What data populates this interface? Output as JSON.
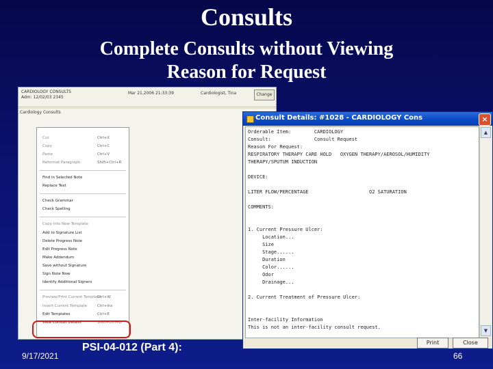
{
  "slide": {
    "title": "Consults",
    "subtitle_line1": "Complete Consults without Viewing",
    "subtitle_line2": "Reason for Request"
  },
  "left_screen": {
    "patient_name": "CARDIOLOGY CONSULTS",
    "admission": "Adm: 12/02/03 2345",
    "date_time": "Mar 21,2006 21:33:39",
    "provider": "Cardiologist, Tina",
    "change_button": "Change",
    "tab_label": "Cardiology Consults",
    "context_menu": [
      {
        "label": "Cut",
        "shortcut": "Ctrl+X",
        "disabled": true
      },
      {
        "label": "Copy",
        "shortcut": "Ctrl+C",
        "disabled": true
      },
      {
        "label": "Paste",
        "shortcut": "Ctrl+V",
        "disabled": true
      },
      {
        "label": "Reformat Paragraph",
        "shortcut": "Shift+Ctrl+R",
        "disabled": true
      },
      {
        "label": "Find in Selected Note",
        "shortcut": "",
        "disabled": false
      },
      {
        "label": "Replace Text",
        "shortcut": "",
        "disabled": false
      },
      {
        "label": "Check Grammar",
        "shortcut": "",
        "disabled": false
      },
      {
        "label": "Check Spelling",
        "shortcut": "",
        "disabled": false
      },
      {
        "label": "Copy into New Template",
        "shortcut": "",
        "disabled": true
      },
      {
        "label": "Add to Signature List",
        "shortcut": "",
        "disabled": false
      },
      {
        "label": "Delete Progress Note",
        "shortcut": "",
        "disabled": false
      },
      {
        "label": "Edit Progress Note",
        "shortcut": "",
        "disabled": false
      },
      {
        "label": "Make Addendum",
        "shortcut": "",
        "disabled": false
      },
      {
        "label": "Save without Signature",
        "shortcut": "",
        "disabled": false
      },
      {
        "label": "Sign Note Now",
        "shortcut": "",
        "disabled": false
      },
      {
        "label": "Identify Additional Signers",
        "shortcut": "",
        "disabled": false
      },
      {
        "label": "Preview/Print Current Template",
        "shortcut": "Ctrl+W",
        "disabled": true
      },
      {
        "label": "Insert Current Template",
        "shortcut": "Ctrl+Ins",
        "disabled": true
      },
      {
        "label": "Edit Templates",
        "shortcut": "Ctrl+E",
        "disabled": false
      },
      {
        "label": "View Consult Details",
        "shortcut": "Shift+Ctrl+D",
        "disabled": false
      }
    ]
  },
  "dialog": {
    "title": "Consult Details: #1028 - CARDIOLOGY Cons",
    "lines": [
      "Orderable Item:        CARDIOLOGY",
      "Consult:               Consult Request",
      "Reason For Request:",
      "RESPIRATORY THERAPY CARE HOLD   OXYGEN THERAPY/AEROSOL/HUMIDITY",
      "THERAPY/SPUTUM INDUCTION",
      "",
      "DEVICE:",
      "",
      "LITER FLOW/PERCENTAGE                     O2 SATURATION",
      "",
      "COMMENTS:",
      "",
      "",
      "1. Current Pressure Ulcer:",
      "     Location...",
      "     Size",
      "     Stage......",
      "     Duration",
      "     Color......",
      "     Odor",
      "     Drainage...",
      "",
      "2. Current Treatment of Pressure Ulcer:",
      "",
      "",
      "Inter-facility Information",
      "This is not an inter-facility consult request."
    ],
    "print_button": "Print",
    "close_button": "Close"
  },
  "footer": {
    "date": "9/17/2021",
    "doc_id": "PSI-04-012 (Part 4):",
    "page_number": "66"
  },
  "colors": {
    "background": "#0a1270",
    "title_text": "#ffffff",
    "highlight": "#d01818",
    "titlebar": "#0a4bc9"
  }
}
